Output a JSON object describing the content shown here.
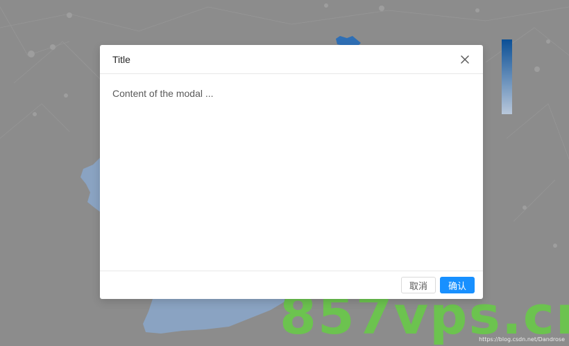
{
  "modal": {
    "title": "Title",
    "content": "Content of the modal ...",
    "cancel_label": "取消",
    "ok_label": "确认"
  },
  "watermark": {
    "text": "857vps.cn",
    "credit": "https://blog.csdn.net/Dandrose"
  },
  "colors": {
    "overlay": "#8c8c8c",
    "primary": "#1890ff",
    "map_fill": "#8aa3c2",
    "legend_top": "#0a4f96",
    "legend_bottom": "#b9c8db"
  }
}
